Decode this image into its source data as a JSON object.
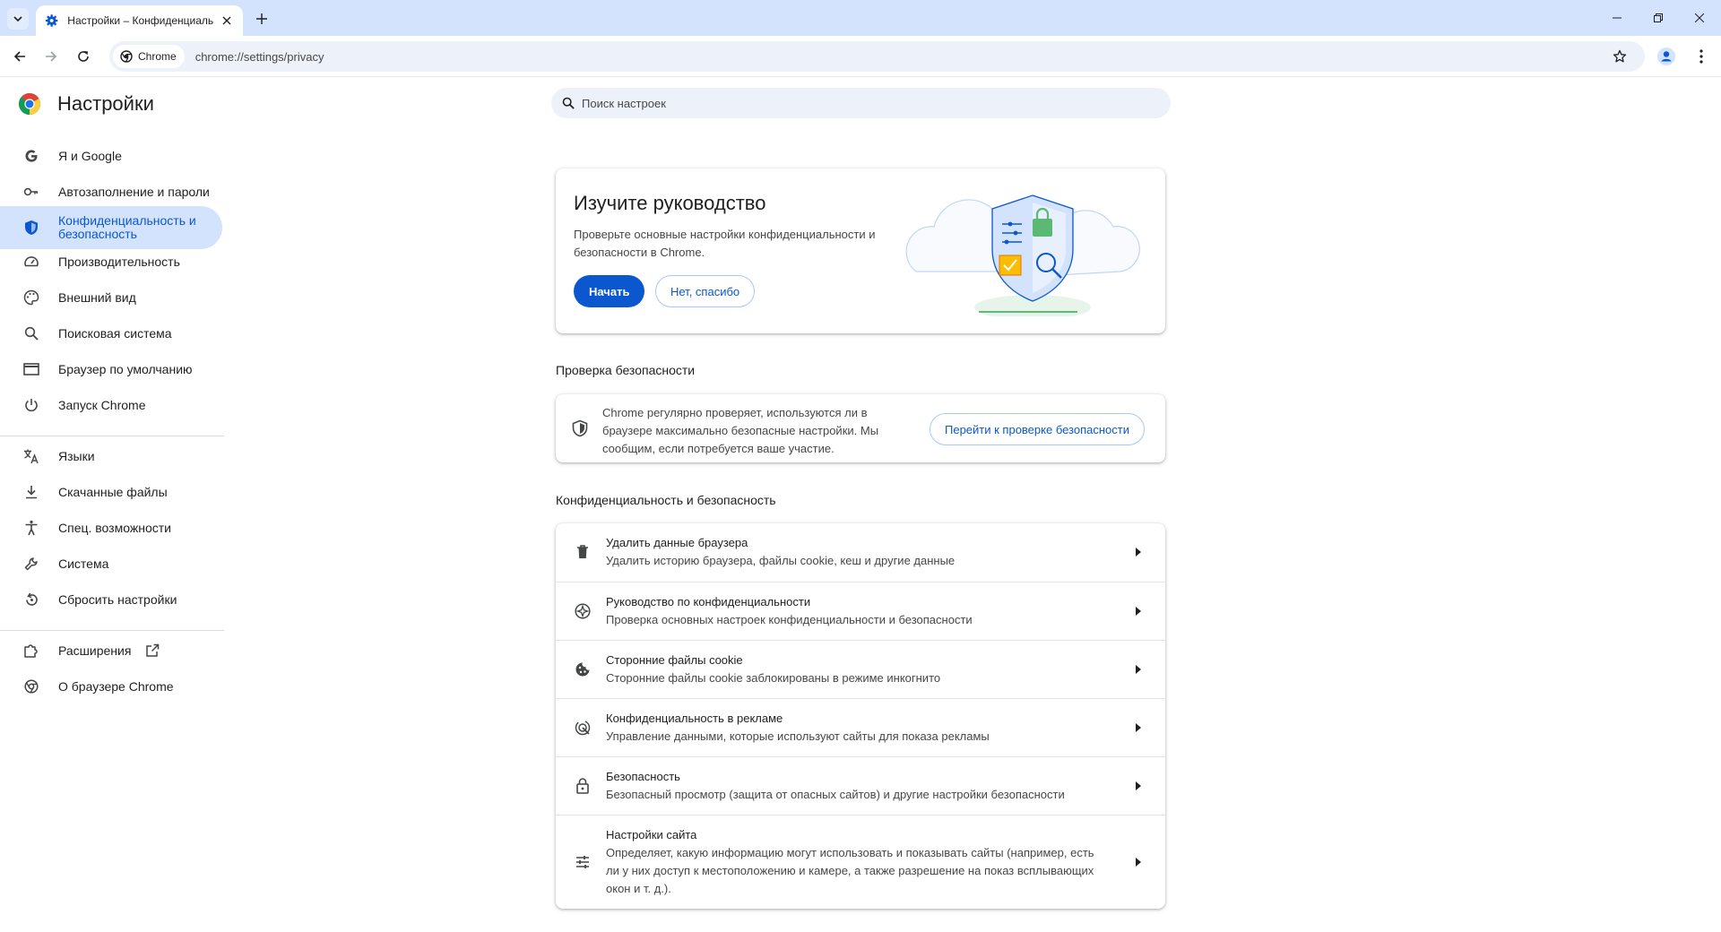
{
  "browser": {
    "tab_title": "Настройки – Конфиденциальность и безопасность",
    "omnibox_chip": "Chrome",
    "url": "chrome://settings/privacy",
    "icons": [
      "tab-search-icon",
      "settings-gear-icon",
      "close-icon",
      "plus-icon",
      "minimize-icon",
      "restore-icon",
      "close-window-icon",
      "back-arrow-icon",
      "forward-arrow-icon",
      "reload-icon",
      "chrome-logo-icon",
      "star-icon",
      "profile-icon",
      "more-vert-icon"
    ]
  },
  "sidebar": {
    "title": "Настройки",
    "items": [
      {
        "label": "Я и Google",
        "icon": "google-g-icon"
      },
      {
        "label": "Автозаполнение и пароли",
        "icon": "key-icon"
      },
      {
        "label": "Конфиденциальность и безопасность",
        "icon": "shield-icon",
        "active": true
      },
      {
        "label": "Производительность",
        "icon": "speedometer-icon"
      },
      {
        "label": "Внешний вид",
        "icon": "palette-icon"
      },
      {
        "label": "Поисковая система",
        "icon": "search-icon"
      },
      {
        "label": "Браузер по умолчанию",
        "icon": "browser-window-icon"
      },
      {
        "label": "Запуск Chrome",
        "icon": "power-icon"
      },
      {
        "label": "Языки",
        "icon": "translate-icon"
      },
      {
        "label": "Скачанные файлы",
        "icon": "download-icon"
      },
      {
        "label": "Спец. возможности",
        "icon": "accessibility-icon"
      },
      {
        "label": "Система",
        "icon": "wrench-icon"
      },
      {
        "label": "Сбросить настройки",
        "icon": "reset-icon"
      },
      {
        "label": "Расширения",
        "icon": "puzzle-icon"
      },
      {
        "label": "О браузере Chrome",
        "icon": "chrome-outline-icon"
      }
    ]
  },
  "search": {
    "placeholder": "Поиск настроек"
  },
  "guide_card": {
    "title": "Изучите руководство",
    "description": "Проверьте основные настройки конфиденциальности и безопасности в Chrome.",
    "start_button": "Начать",
    "decline_button": "Нет, спасибо"
  },
  "safety_check": {
    "heading": "Проверка безопасности",
    "text": "Chrome регулярно проверяет, используются ли в браузере максимально безопасные настройки. Мы сообщим, если потребуется ваше участие.",
    "button": "Перейти к проверке безопасности"
  },
  "privacy_section": {
    "heading": "Конфиденциальность и безопасность",
    "rows": [
      {
        "title": "Удалить данные браузера",
        "subtitle": "Удалить историю браузера, файлы cookie, кеш и другие данные",
        "icon": "trash-icon"
      },
      {
        "title": "Руководство по конфиденциальности",
        "subtitle": "Проверка основных настроек конфиденциальности и безопасности",
        "icon": "compass-icon"
      },
      {
        "title": "Сторонние файлы cookie",
        "subtitle": "Сторонние файлы cookie заблокированы в режиме инкогнито",
        "icon": "cookie-icon"
      },
      {
        "title": "Конфиденциальность в рекламе",
        "subtitle": "Управление данными, которые используют сайты для показа рекламы",
        "icon": "ad-privacy-icon"
      },
      {
        "title": "Безопасность",
        "subtitle": "Безопасный просмотр (защита от опасных сайтов) и другие настройки безопасности",
        "icon": "lock-icon"
      },
      {
        "title": "Настройки сайта",
        "subtitle": "Определяет, какую информацию могут использовать и показывать сайты (например, есть ли у них доступ к местоположению и камере, а также разрешение на показ всплывающих окон и т. д.).",
        "icon": "tune-icon"
      }
    ]
  },
  "colors": {
    "accent": "#0b57d0",
    "titlebar": "#d3e3fd",
    "active_nav_bg": "#d3e3fd",
    "omnibox_bg": "#edf2fa"
  }
}
